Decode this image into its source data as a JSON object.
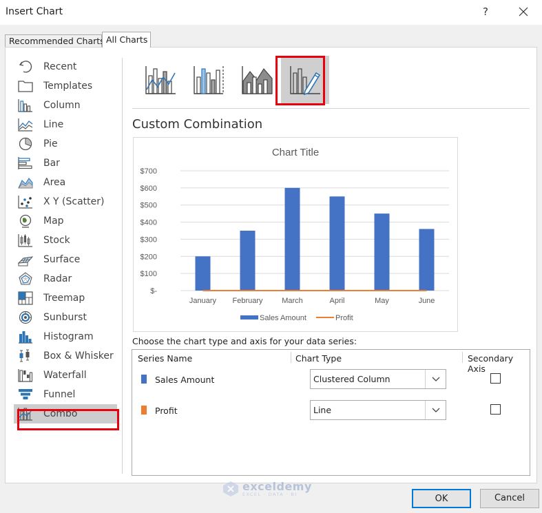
{
  "window": {
    "title": "Insert Chart",
    "help": "?"
  },
  "tabs": [
    {
      "label": "Recommended Charts",
      "active": false
    },
    {
      "label": "All Charts",
      "active": true
    }
  ],
  "sidebar": {
    "items": [
      {
        "label": "Recent",
        "icon": "recent-icon"
      },
      {
        "label": "Templates",
        "icon": "templates-icon"
      },
      {
        "label": "Column",
        "icon": "column-chart-icon"
      },
      {
        "label": "Line",
        "icon": "line-chart-icon"
      },
      {
        "label": "Pie",
        "icon": "pie-chart-icon"
      },
      {
        "label": "Bar",
        "icon": "bar-chart-icon"
      },
      {
        "label": "Area",
        "icon": "area-chart-icon"
      },
      {
        "label": "X Y (Scatter)",
        "icon": "scatter-chart-icon"
      },
      {
        "label": "Map",
        "icon": "map-chart-icon"
      },
      {
        "label": "Stock",
        "icon": "stock-chart-icon"
      },
      {
        "label": "Surface",
        "icon": "surface-chart-icon"
      },
      {
        "label": "Radar",
        "icon": "radar-chart-icon"
      },
      {
        "label": "Treemap",
        "icon": "treemap-chart-icon"
      },
      {
        "label": "Sunburst",
        "icon": "sunburst-chart-icon"
      },
      {
        "label": "Histogram",
        "icon": "histogram-chart-icon"
      },
      {
        "label": "Box & Whisker",
        "icon": "box-whisker-chart-icon"
      },
      {
        "label": "Waterfall",
        "icon": "waterfall-chart-icon"
      },
      {
        "label": "Funnel",
        "icon": "funnel-chart-icon"
      },
      {
        "label": "Combo",
        "icon": "combo-chart-icon",
        "selected": true
      }
    ]
  },
  "subtypes": [
    {
      "icon": "clustered-column-line-icon",
      "selected": false
    },
    {
      "icon": "clustered-column-line-secondary-axis-icon",
      "selected": false
    },
    {
      "icon": "stacked-area-clustered-column-icon",
      "selected": false
    },
    {
      "icon": "custom-combination-icon",
      "selected": true
    }
  ],
  "section_title": "Custom Combination",
  "chart_data": {
    "type": "bar",
    "title": "Chart Title",
    "categories": [
      "January",
      "February",
      "March",
      "April",
      "May",
      "June"
    ],
    "series": [
      {
        "name": "Sales Amount",
        "type": "bar",
        "color": "#4472c4",
        "values": [
          200,
          350,
          600,
          550,
          450,
          360
        ]
      },
      {
        "name": "Profit",
        "type": "line",
        "color": "#ed7d31",
        "values": [
          0,
          0,
          0,
          0,
          0,
          0
        ]
      }
    ],
    "ylim": [
      0,
      700
    ],
    "yticks": [
      0,
      100,
      200,
      300,
      400,
      500,
      600,
      700
    ],
    "ytick_labels": [
      "$-",
      "$100",
      "$200",
      "$300",
      "$400",
      "$500",
      "$600",
      "$700"
    ],
    "grid": true,
    "legend": "bottom"
  },
  "choose_label": "Choose the chart type and axis for your data series:",
  "table": {
    "headers": {
      "series_name": "Series Name",
      "chart_type": "Chart Type",
      "secondary_axis": "Secondary Axis"
    },
    "rows": [
      {
        "name": "Sales Amount",
        "color": "#4472c4",
        "chart_type": "Clustered Column",
        "secondary": false
      },
      {
        "name": "Profit",
        "color": "#ed7d31",
        "chart_type": "Line",
        "secondary": false
      }
    ]
  },
  "buttons": {
    "ok": "OK",
    "cancel": "Cancel"
  },
  "watermark": {
    "name": "exceldemy",
    "tagline": "EXCEL · DATA · BI"
  }
}
